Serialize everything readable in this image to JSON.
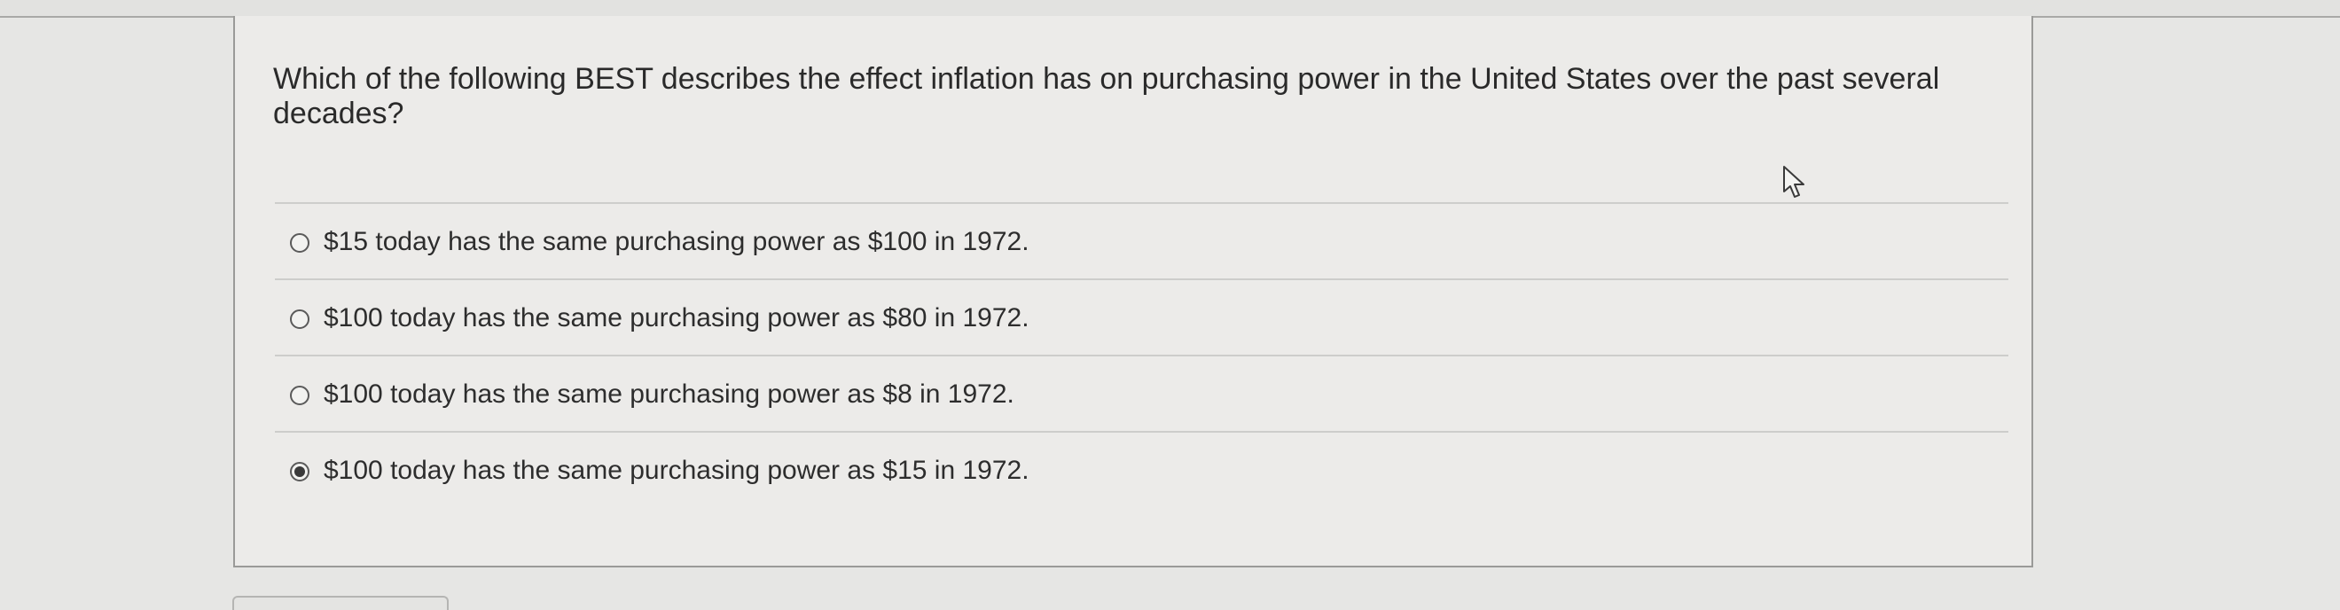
{
  "question": {
    "text": "Which of the following BEST describes the effect inflation has on purchasing power in the United States over the past several decades?"
  },
  "options": [
    {
      "label": "$15 today has the same purchasing power as $100 in 1972.",
      "selected": false
    },
    {
      "label": "$100 today has the same purchasing power as $80 in 1972.",
      "selected": false
    },
    {
      "label": "$100 today has the same purchasing power as $8 in 1972.",
      "selected": false
    },
    {
      "label": "$100 today has the same purchasing power as $15 in 1972.",
      "selected": true
    }
  ],
  "icons": {
    "cursor": "mouse-pointer-icon"
  }
}
